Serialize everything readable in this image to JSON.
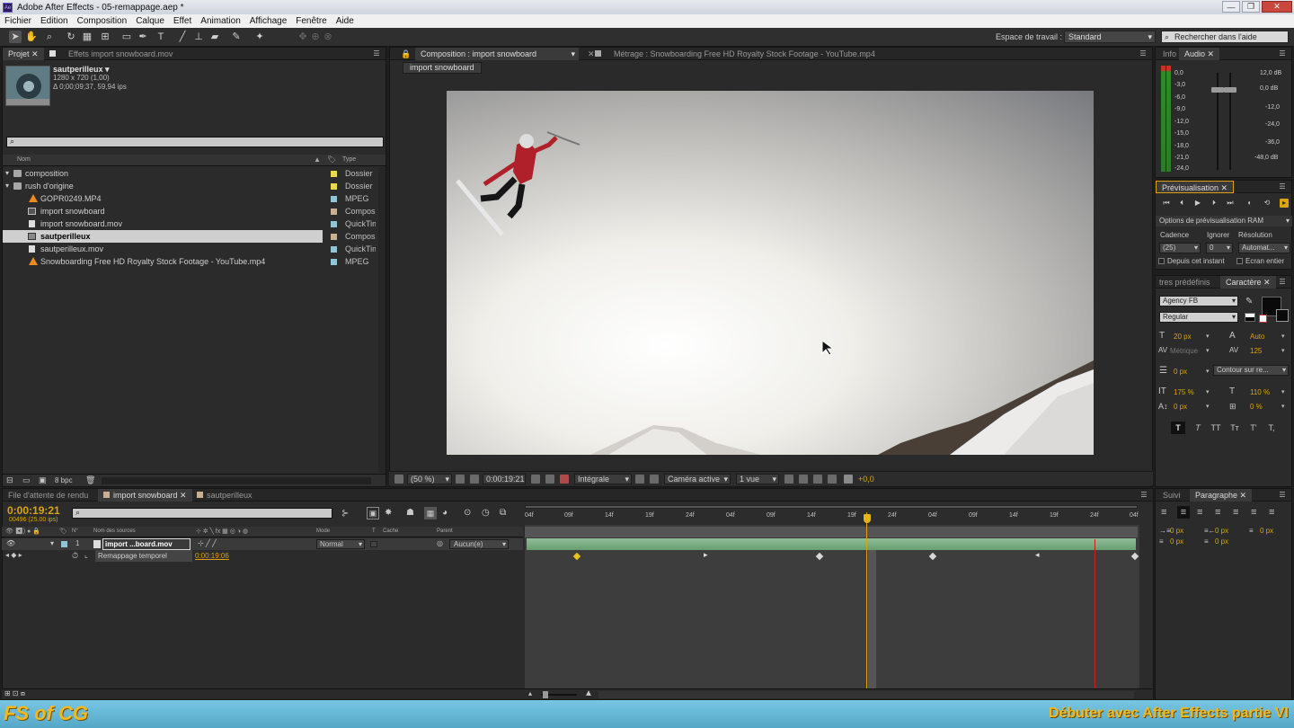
{
  "window": {
    "title": "Adobe After Effects - 05-remappage.aep *",
    "min": "—",
    "max": "❐",
    "close": "✕"
  },
  "menu": [
    "Fichier",
    "Edition",
    "Composition",
    "Calque",
    "Effet",
    "Animation",
    "Affichage",
    "Fenêtre",
    "Aide"
  ],
  "toolbar": {
    "workspace_label": "Espace de travail :",
    "workspace_value": "Standard",
    "search_help": "Rechercher dans l'aide"
  },
  "project": {
    "tab_project": "Projet",
    "tab_effects": "Effets import snowboard.mov",
    "item_name": "sautperilleux ▾",
    "item_size": "1280 x 720 (1,00)",
    "item_duration": "Δ 0;00;09;37, 59,94 ips",
    "search_placeholder": "",
    "col_name": "Nom",
    "col_type": "Type",
    "bpc": "8 bpc",
    "rows": [
      {
        "name": "composition",
        "type": "Dossier",
        "label": "#e8d84a"
      },
      {
        "name": "rush d'origine",
        "type": "Dossier",
        "label": "#e8d84a"
      },
      {
        "name": "GOPR0249.MP4",
        "type": "MPEG",
        "label": "#8fc6d6"
      },
      {
        "name": "import snowboard",
        "type": "Composi",
        "label": "#c8b090"
      },
      {
        "name": "import snowboard.mov",
        "type": "QuickTim",
        "label": "#8fc6d6"
      },
      {
        "name": "sautperilleux",
        "type": "Composi",
        "label": "#c8b090"
      },
      {
        "name": "sautperilleux.mov",
        "type": "QuickTim",
        "label": "#8fc6d6"
      },
      {
        "name": "Snowboarding Free HD Royalty Stock Footage - YouTube.mp4",
        "type": "MPEG",
        "label": "#8fc6d6"
      }
    ]
  },
  "viewer": {
    "tab_comp": "Composition : import snowboard",
    "tab_footage": "Métrage : Snowboarding Free HD Royalty Stock Footage - YouTube.mp4",
    "breadcrumb": "import snowboard",
    "zoom": "(50 %)",
    "timecode": "0:00:19:21",
    "resolution": "Intégrale",
    "camera": "Caméra active",
    "views": "1 vue",
    "exposure": "+0,0"
  },
  "info_audio": {
    "tab_info": "Info",
    "tab_audio": "Audio",
    "left_scale": [
      "0,0",
      "-3,0",
      "-6,0",
      "-9,0",
      "-12,0",
      "-15,0",
      "-18,0",
      "-21,0",
      "-24,0"
    ],
    "right_scale": [
      "12,0 dB",
      "0,0 dB",
      "-12,0",
      "-24,0",
      "-36,0",
      "-48,0 dB"
    ]
  },
  "preview": {
    "tab": "Prévisualisation",
    "ram_options": "Options de prévisualisation RAM",
    "cadence_label": "Cadence",
    "ignore_label": "Ignorer",
    "resolution_label": "Résolution",
    "cadence_value": "(25)",
    "ignore_value": "0",
    "resolution_value": "Automat...",
    "from_now": "Depuis cet instant",
    "fullscreen": "Ecran entier"
  },
  "character": {
    "tab_presets": "tres prédéfinis",
    "tab_char": "Caractère",
    "font": "Agency FB",
    "style": "Regular",
    "size": "20 px",
    "leading": "Auto",
    "kerning": "Métrique",
    "tracking": "125",
    "stroke_width": "0 px",
    "stroke_mode": "Contour sur re...",
    "vscale": "175 %",
    "hscale": "110 %",
    "baseline": "0 px",
    "tsume": "0 %",
    "styles": [
      "T",
      "T",
      "TT",
      "Tт",
      "T'",
      "T,"
    ]
  },
  "paragraph": {
    "tab_track": "Suivi",
    "tab_para": "Paragraphe",
    "indent1": "0 px",
    "indent2": "0 px",
    "indent3": "0 px",
    "space1": "0 px",
    "space2": "0 px"
  },
  "timeline": {
    "tab_render": "File d'attente de rendu",
    "tab_import": "import snowboard",
    "tab_saut": "sautperilleux",
    "timecode": "0:00:19:21",
    "fps": "00496 (25.00 ips)",
    "search_placeholder": "",
    "col_num": "N°",
    "col_source": "Nom des sources",
    "col_mode": "Mode",
    "col_t": "T",
    "col_cache": "Cache",
    "col_parent": "Parent",
    "layer_num": "1",
    "layer_name": "import ...board.mov",
    "layer_mode": "Normal",
    "layer_parent": "Aucun(e)",
    "prop_name": "Remappage temporel",
    "prop_value": "0:00:19:06",
    "ruler": [
      "04f",
      "09f",
      "14f",
      "19f",
      "24f",
      "04f",
      "09f",
      "14f",
      "19f",
      "24f",
      "04f",
      "09f",
      "14f",
      "19f",
      "24f",
      "04f"
    ]
  },
  "footer": {
    "logo": "FS of CG",
    "title": "Débuter avec After Effects partie VI"
  },
  "colors": {
    "accent_orange": "#d9a40f",
    "timeline_bar": "#7fbf86",
    "footer_blue": "#62b4d4"
  }
}
